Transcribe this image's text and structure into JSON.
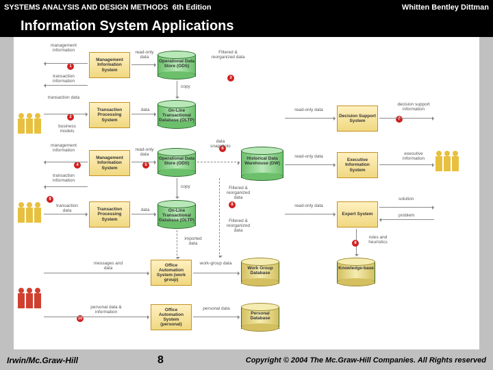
{
  "header": {
    "book": "SYSTEMS ANALYSIS AND DESIGN METHODS",
    "edition": "6th Edition",
    "authors": "Whitten   Bentley   Dittman",
    "slide_title": "Information System Applications"
  },
  "footer": {
    "publisher": "Irwin/Mc.Graw-Hill",
    "page": "8",
    "copyright": "Copyright © 2004 The Mc.Graw-Hill Companies. All Rights reserved"
  },
  "nodes": {
    "mis1": "Management Information System",
    "tps1": "Transaction Processing System",
    "mis2": "Management Information System",
    "tps2": "Transaction Processing System",
    "ods1": "Operational Data Store (ODS)",
    "oltp1": "On-Line Transactional Database (OLTP)",
    "ods2": "Operational Data Store (ODS)",
    "oltp2": "On-Line Transactional Database (OLTP)",
    "oas_wg": "Office Automation System (work group)",
    "oas_p": "Office Automation System (personal)",
    "dw": "Historical Data Warehouse (DW)",
    "wgdb": "Work Group Database",
    "pdb": "Personal Database",
    "dss": "Decision Support System",
    "eis": "Executive Information System",
    "es": "Expert System",
    "kb": "Knowledge-base"
  },
  "edges": {
    "mgmt_info": "management information",
    "trans_info": "transaction information",
    "trans_data": "transaction data",
    "biz_models": "business models",
    "ro_data": "read-only data",
    "data": "data",
    "copy": "copy",
    "filt_reorg": "Filtered & reorganized data",
    "data_snap": "data snapshots",
    "ro_only": "read-only data",
    "dsi": "decision support information",
    "exec_info": "executive information",
    "solution": "solution",
    "problem": "problem",
    "rules": "rules and heuristics",
    "msgs": "messages and data",
    "wg_data": "work-group data",
    "imported": "imported data",
    "pers_data": "personal data",
    "pdi": "personal data & information"
  },
  "markers": [
    "1",
    "2",
    "3",
    "4",
    "5",
    "6",
    "7",
    "8",
    "9",
    "10"
  ]
}
